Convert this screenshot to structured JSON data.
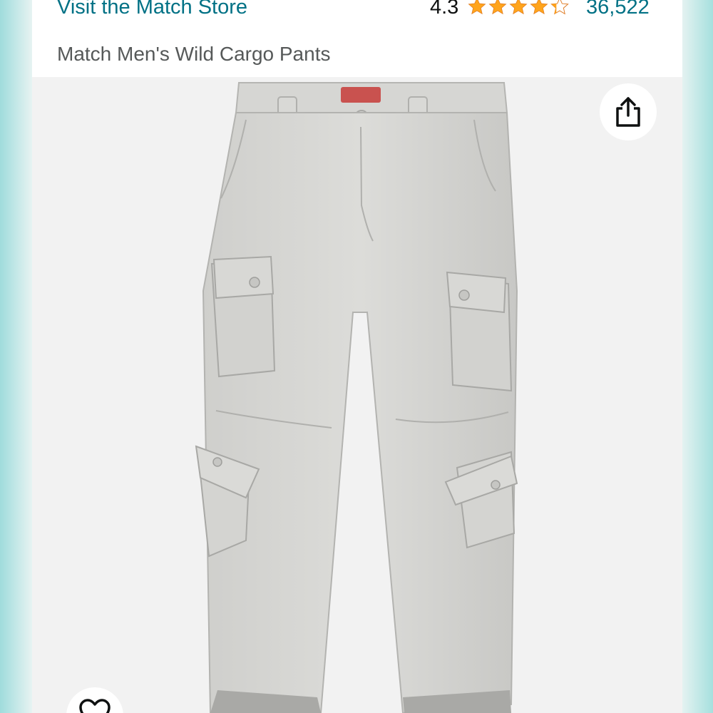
{
  "header": {
    "store_link": "Visit the Match Store",
    "rating": "4.3",
    "rating_value": 4.3,
    "rating_max": 5,
    "review_count": "36,522",
    "star_color": "#ffa41c",
    "link_color": "#007185"
  },
  "product": {
    "title": "Match Men's Wild Cargo Pants",
    "image_description_icon": "cargo-pants-product-photo"
  },
  "actions": {
    "share_icon": "share-icon",
    "wishlist_icon": "heart-icon"
  }
}
